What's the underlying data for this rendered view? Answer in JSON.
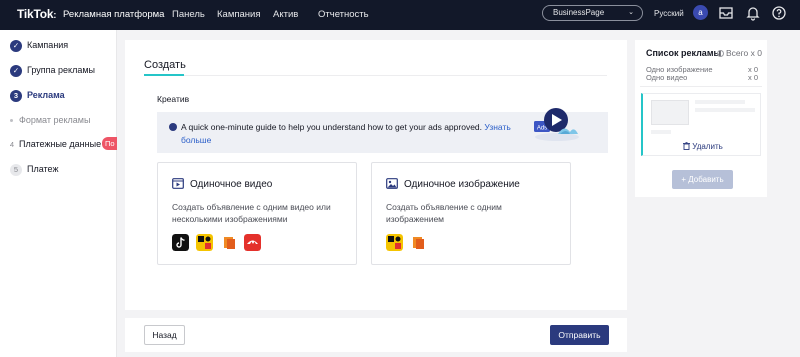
{
  "header": {
    "logo": "TikTok",
    "logo_suffix": ":",
    "platform": "Рекламная платформа",
    "nav": [
      "Панель",
      "Кампания",
      "Актив",
      "Отчетность"
    ],
    "account": "BusinessPage",
    "language": "Русский",
    "avatar_letter": "a"
  },
  "sidebar": {
    "steps": [
      {
        "label": "Кампания",
        "state": "done"
      },
      {
        "label": "Группа рекламы",
        "state": "done"
      },
      {
        "label": "Реклама",
        "number": "3",
        "state": "active"
      },
      {
        "label": "Платежные данные",
        "number": "4",
        "state": "todo"
      },
      {
        "label": "Платеж",
        "number": "5",
        "state": "todo"
      }
    ],
    "substep": "Формат рекламы",
    "badge": "По"
  },
  "main": {
    "tab": "Создать",
    "section_label": "Креатив",
    "guide_text": "A quick one-minute guide to help you understand how to get your ads approved.",
    "guide_link": "Узнать больше",
    "guide_badge": "Ads",
    "options": [
      {
        "title": "Одиночное видео",
        "description": "Создать объявление с одним видео или несколькими изображениями"
      },
      {
        "title": "Одиночное изображение",
        "description": "Создать объявление с одним изображением"
      }
    ]
  },
  "footer": {
    "back": "Назад",
    "send": "Отправить"
  },
  "right_panel": {
    "title": "Список рекламы",
    "all_label": "Всего x 0",
    "rows": [
      {
        "label": "Одно изображение",
        "count": "x 0"
      },
      {
        "label": "Одно видео",
        "count": "x 0"
      }
    ],
    "delete": "Удалить",
    "add": "+ Добавить"
  },
  "colors": {
    "header_bg": "#121829",
    "accent": "#2b3a7e",
    "teal": "#25c5c8",
    "link": "#2d60c9"
  }
}
